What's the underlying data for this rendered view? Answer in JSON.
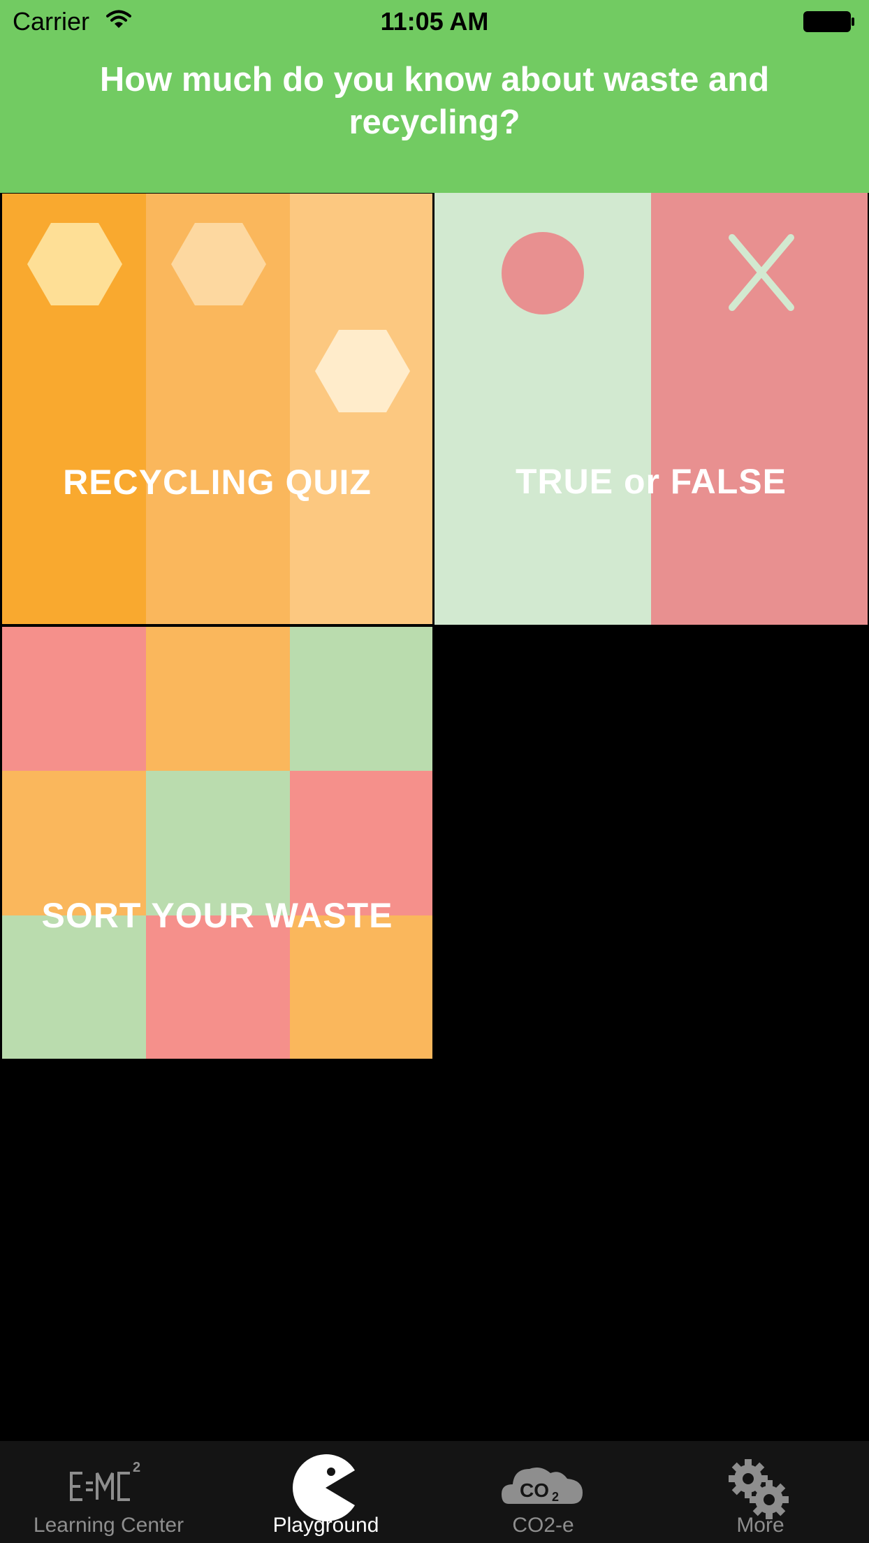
{
  "status_bar": {
    "carrier": "Carrier",
    "time": "11:05 AM"
  },
  "header": {
    "title": "How much do you know about waste and recycling?"
  },
  "tiles": {
    "recycling_quiz": {
      "label": "RECYCLING QUIZ"
    },
    "true_or_false": {
      "label": "TRUE or FALSE"
    },
    "sort_your_waste": {
      "label": "SORT YOUR WASTE"
    }
  },
  "tab_bar": {
    "tabs": [
      {
        "label": "Learning Center",
        "icon": "emc2-icon",
        "active": false
      },
      {
        "label": "Playground",
        "icon": "pacman-icon",
        "active": true
      },
      {
        "label": "CO2-e",
        "icon": "co2-cloud-icon",
        "active": false
      },
      {
        "label": "More",
        "icon": "gears-icon",
        "active": false
      }
    ]
  },
  "colors": {
    "header_green": "#72cb62",
    "orange_dark": "#f9a92f",
    "orange_mid": "#fab75c",
    "orange_light": "#fcc880",
    "mint": "#d2e9d0",
    "salmon": "#e89090",
    "grid_red": "#f5908b",
    "grid_orange": "#fab75c",
    "grid_green": "#badcae"
  }
}
